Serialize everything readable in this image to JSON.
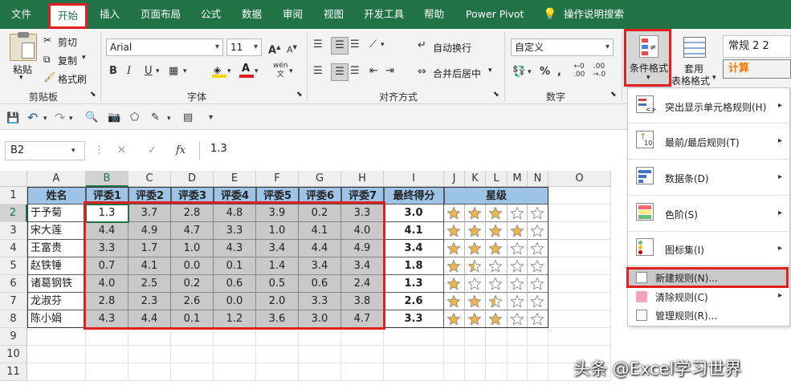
{
  "tabs": [
    "文件",
    "开始",
    "插入",
    "页面布局",
    "公式",
    "数据",
    "审阅",
    "视图",
    "开发工具",
    "帮助",
    "Power Pivot",
    "操作说明搜索"
  ],
  "clipboard": {
    "paste": "粘贴",
    "cut": "剪切",
    "copy": "复制",
    "format_painter": "格式刷",
    "group": "剪贴板"
  },
  "font": {
    "name": "Arial",
    "size": "11",
    "group": "字体",
    "bold": "B",
    "italic": "I",
    "underline": "U",
    "grow": "A",
    "shrink": "A",
    "phonetic": "wén"
  },
  "align": {
    "wrap": "自动换行",
    "merge": "合并后居中",
    "group": "对齐方式"
  },
  "number": {
    "format": "自定义",
    "group": "数字",
    "percent": "%",
    "comma": ","
  },
  "styles": {
    "cond_format": "条件格式",
    "table_format_1": "套用",
    "table_format_2": "表格格式",
    "style_1": "常规 2 2",
    "style_2": "计算"
  },
  "formula_bar": {
    "name_box": "B2",
    "value": "1.3",
    "cancel": "✕",
    "enter": "✓",
    "fx": "fx"
  },
  "columns": [
    "A",
    "B",
    "C",
    "D",
    "E",
    "F",
    "G",
    "H",
    "I",
    "J",
    "K",
    "L",
    "M",
    "N",
    "O"
  ],
  "rows": [
    "1",
    "2",
    "3",
    "4",
    "5",
    "6",
    "7",
    "8",
    "9",
    "10",
    "11"
  ],
  "table": {
    "headers": [
      "姓名",
      "评委1",
      "评委2",
      "评委3",
      "评委4",
      "评委5",
      "评委6",
      "评委7",
      "最终得分",
      "星级"
    ],
    "records": [
      {
        "name": "于予菊",
        "scores": [
          "1.3",
          "3.7",
          "2.8",
          "4.8",
          "3.9",
          "0.2",
          "3.3"
        ],
        "final": "3.0",
        "stars": 3
      },
      {
        "name": "宋大莲",
        "scores": [
          "4.4",
          "4.9",
          "4.7",
          "3.3",
          "1.0",
          "4.1",
          "4.0"
        ],
        "final": "4.1",
        "stars": 4
      },
      {
        "name": "王富贵",
        "scores": [
          "3.3",
          "1.7",
          "1.0",
          "4.3",
          "3.4",
          "4.4",
          "4.9"
        ],
        "final": "3.4",
        "stars": 3
      },
      {
        "name": "赵铁锤",
        "scores": [
          "0.7",
          "4.1",
          "0.0",
          "0.1",
          "1.4",
          "3.4",
          "3.4"
        ],
        "final": "1.8",
        "stars": 1.5
      },
      {
        "name": "诸葛钢铁",
        "scores": [
          "4.0",
          "2.5",
          "0.2",
          "0.6",
          "0.5",
          "0.6",
          "2.4"
        ],
        "final": "1.3",
        "stars": 1
      },
      {
        "name": "龙淑芬",
        "scores": [
          "2.8",
          "2.3",
          "2.6",
          "0.0",
          "2.0",
          "3.3",
          "3.8"
        ],
        "final": "2.6",
        "stars": 2.5
      },
      {
        "name": "陈小娟",
        "scores": [
          "4.3",
          "4.4",
          "0.1",
          "1.2",
          "3.6",
          "3.0",
          "4.7"
        ],
        "final": "3.3",
        "stars": 3
      }
    ]
  },
  "menu": [
    {
      "label": "突出显示单元格规则(H)",
      "icon": "highlight-rules-icon"
    },
    {
      "label": "最前/最后规则(T)",
      "icon": "top-bottom-icon"
    },
    {
      "label": "数据条(D)",
      "icon": "data-bars-icon"
    },
    {
      "label": "色阶(S)",
      "icon": "color-scales-icon"
    },
    {
      "label": "图标集(I)",
      "icon": "icon-sets-icon"
    },
    {
      "label": "新建规则(N)...",
      "icon": "new-rule-icon"
    },
    {
      "label": "清除规则(C)",
      "icon": "clear-rules-icon"
    },
    {
      "label": "管理规则(R)...",
      "icon": "manage-rules-icon"
    }
  ],
  "watermark": "头条 @Excel学习世界",
  "colors": {
    "excel_green": "#217346",
    "header_blue": "#9dc3e6",
    "highlight_red": "#e02020",
    "star_gold": "#f0b64a",
    "data_gray": "#c9c9c9"
  }
}
